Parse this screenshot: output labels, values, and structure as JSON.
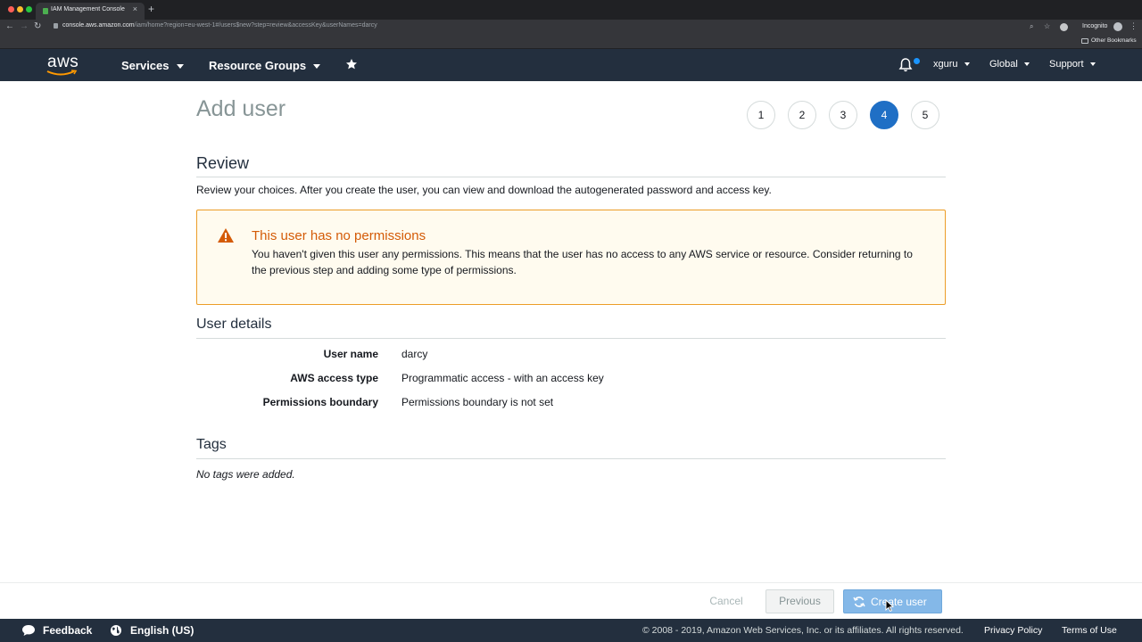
{
  "browser": {
    "tab_title": "IAM Management Console",
    "url_host": "console.aws.amazon.com",
    "url_path": "/iam/home?region=eu-west-1#/users$new?step=review&accessKey&userNames=darcy",
    "incognito_label": "Incognito",
    "bookmarks_label": "Other Bookmarks"
  },
  "awsnav": {
    "logo_text": "aws",
    "services_label": "Services",
    "resource_groups_label": "Resource Groups",
    "username": "xguru",
    "region": "Global",
    "support": "Support"
  },
  "page": {
    "title": "Add user",
    "steps": [
      "1",
      "2",
      "3",
      "4",
      "5"
    ],
    "active_step": 4
  },
  "review": {
    "title": "Review",
    "description": "Review your choices. After you create the user, you can view and download the autogenerated password and access key."
  },
  "warning": {
    "title": "This user has no permissions",
    "text": "You haven't given this user any permissions. This means that the user has no access to any AWS service or resource. Consider returning to the previous step and adding some type of permissions."
  },
  "user_details": {
    "title": "User details",
    "rows": [
      {
        "label": "User name",
        "value": "darcy"
      },
      {
        "label": "AWS access type",
        "value": "Programmatic access - with an access key"
      },
      {
        "label": "Permissions boundary",
        "value": "Permissions boundary is not set"
      }
    ]
  },
  "tags": {
    "title": "Tags",
    "empty_text": "No tags were added."
  },
  "actions": {
    "cancel": "Cancel",
    "previous": "Previous",
    "create": "Create user"
  },
  "footer": {
    "feedback": "Feedback",
    "language": "English (US)",
    "copyright": "© 2008 - 2019, Amazon Web Services, Inc. or its affiliates. All rights reserved.",
    "privacy": "Privacy Policy",
    "terms": "Terms of Use"
  },
  "colors": {
    "nav_bg": "#232f3e",
    "active_step": "#1f6fc5",
    "warning_border": "#ec9d28",
    "warning_title": "#d45b07",
    "primary_button": "#84b8e8"
  },
  "icons": {
    "bell": "bell-icon",
    "pin": "pin-icon",
    "warning": "warning-triangle-icon",
    "refresh": "refresh-icon",
    "feedback": "speech-bubble-icon",
    "globe": "globe-icon"
  }
}
